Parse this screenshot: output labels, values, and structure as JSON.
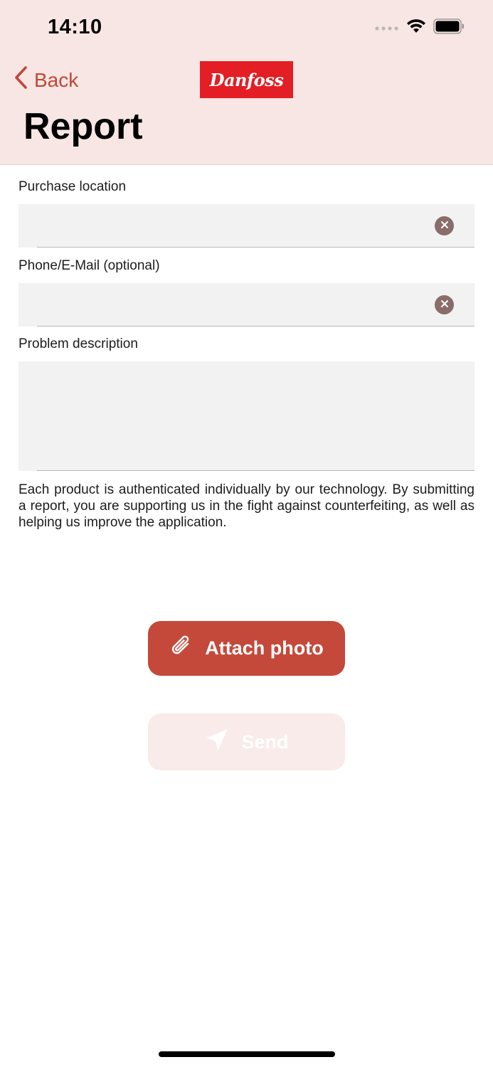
{
  "status_bar": {
    "time": "14:10"
  },
  "nav": {
    "back_label": "Back",
    "logo_text": "Danfoss",
    "title": "Report"
  },
  "form": {
    "purchase_location": {
      "label": "Purchase location",
      "value": "",
      "placeholder": ""
    },
    "contact": {
      "label": "Phone/E-Mail (optional)",
      "value": "",
      "placeholder": ""
    },
    "problem_description": {
      "label": "Problem description",
      "value": "",
      "placeholder": ""
    },
    "disclaimer": "Each product is authenticated individually by our technology. By submitting a report, you are supporting us in the fight against counterfeiting, as well as helping us improve the application."
  },
  "actions": {
    "attach_label": "Attach photo",
    "send_label": "Send",
    "send_enabled": false
  },
  "colors": {
    "accent": "#c4493a",
    "header_bg": "#f7e6e3",
    "brand_red": "#e31e24",
    "field_bg": "#f2f2f2",
    "disabled_bg": "#f9ebe9"
  },
  "icons": {
    "back": "chevron-left-icon",
    "clear": "clear-circle-icon",
    "attach": "paperclip-icon",
    "send": "paper-plane-icon",
    "signal": "cellular-signal-icon",
    "wifi": "wifi-icon",
    "battery": "battery-icon"
  }
}
